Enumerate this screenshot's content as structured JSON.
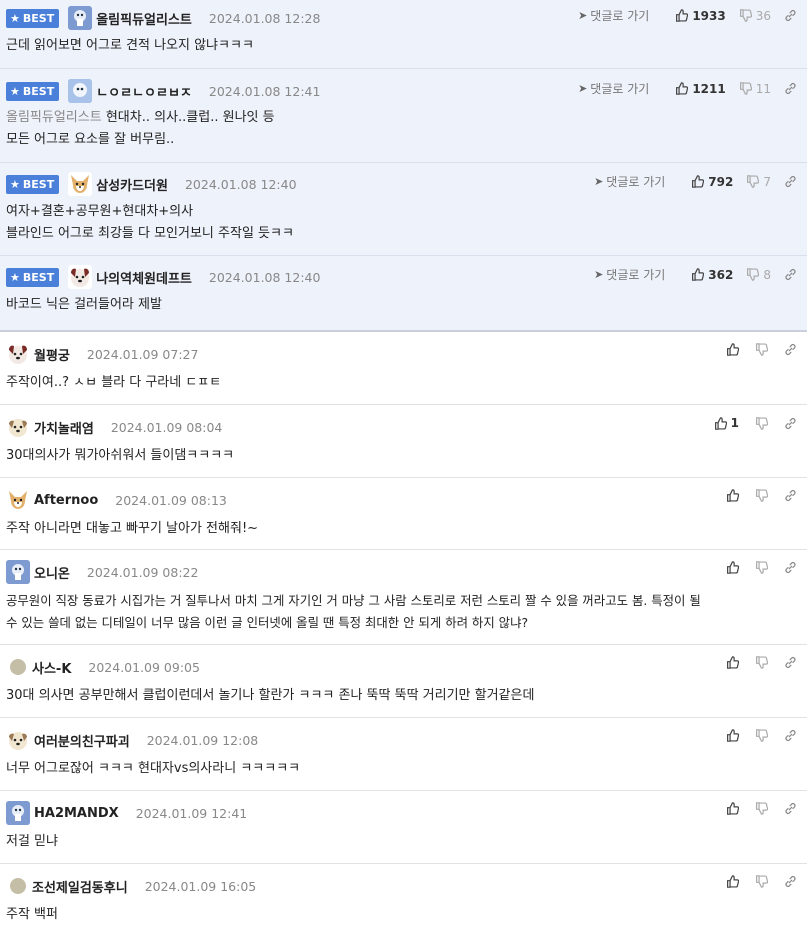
{
  "best_label": "BEST",
  "goto_label": "댓글로 가기",
  "best_comments": [
    {
      "nick": "올림픽듀얼리스트",
      "date": "2024.01.08 12:28",
      "up": "1933",
      "down": "36",
      "avatar": "lock",
      "lines": [
        "근데 읽어보면 어그로 견적 나오지 않냐ㅋㅋㅋ"
      ]
    },
    {
      "nick": "ㄴㅇㄹㄴㅇㄹㅂㅈ",
      "date": "2024.01.08 12:41",
      "up": "1211",
      "down": "11",
      "avatar": "lock2",
      "quote": "올림픽듀얼리스트",
      "lines": [
        "현대차.. 의사..클럽.. 원나잇 등",
        "모든 어그로 요소를 잘 버무림.."
      ]
    },
    {
      "nick": "삼성카드더원",
      "date": "2024.01.08 12:40",
      "up": "792",
      "down": "7",
      "avatar": "cat",
      "lines": [
        "여자+결혼+공무원+현대차+의사",
        "블라인드 어그로 최강들 다 모인거보니 주작일 듯ㅋㅋ"
      ]
    },
    {
      "nick": "나의역체원데프트",
      "date": "2024.01.08 12:40",
      "up": "362",
      "down": "8",
      "avatar": "dog",
      "lines": [
        "바코드 닉은 걸러들어라 제발"
      ]
    }
  ],
  "comments": [
    {
      "nick": "월평궁",
      "date": "2024.01.09 07:27",
      "up": "",
      "avatar": "dog",
      "lines": [
        "주작이여..? ㅅㅂ 블라 다 구라네 ㄷㅍㅌ"
      ]
    },
    {
      "nick": "가치놀래염",
      "date": "2024.01.09 08:04",
      "up": "1",
      "avatar": "puppy",
      "lines": [
        "30대의사가 뭐가아쉬워서 들이댐ㅋㅋㅋㅋ"
      ]
    },
    {
      "nick": "Afternoo",
      "date": "2024.01.09 08:13",
      "up": "",
      "avatar": "cat",
      "lines": [
        "주작 아니라면 대놓고 빠꾸기 날아가 전해줘!~"
      ]
    },
    {
      "nick": "오니온",
      "date": "2024.01.09 08:22",
      "up": "",
      "avatar": "lock",
      "lines": [
        "공무원이 직장 동료가 시집가는 거 질투나서 마치 그게 자기인 거 마냥 그 사람 스토리로 저런 스토리 짤 수 있을 꺼라고도 봄. 특정이 될",
        "수 있는 쓸데 없는 디테일이 너무 많음 이런 글 인터넷에 올릴 땐 특정 최대한 안 되게 하려 하지 않냐?"
      ]
    },
    {
      "nick": "사스-K",
      "date": "2024.01.09 09:05",
      "up": "",
      "avatar": "dot",
      "lines": [
        "30대 의사면 공부만해서 클럽이런데서 놀기나 할란가 ㅋㅋㅋ 존나 뚝딱 뚝딱 거리기만 할거같은데"
      ]
    },
    {
      "nick": "여러분의친구파괴",
      "date": "2024.01.09 12:08",
      "up": "",
      "avatar": "puppy",
      "lines": [
        "너무 어그로잖어 ㅋㅋㅋ 현대자vs의사라니 ㅋㅋㅋㅋㅋ"
      ]
    },
    {
      "nick": "HA2MANDX",
      "date": "2024.01.09 12:41",
      "up": "",
      "avatar": "lock",
      "lines": [
        "저걸 믿냐"
      ]
    },
    {
      "nick": "조선제일검동후니",
      "date": "2024.01.09 16:05",
      "up": "",
      "avatar": "dot",
      "lines": [
        "주작 백퍼"
      ]
    }
  ]
}
